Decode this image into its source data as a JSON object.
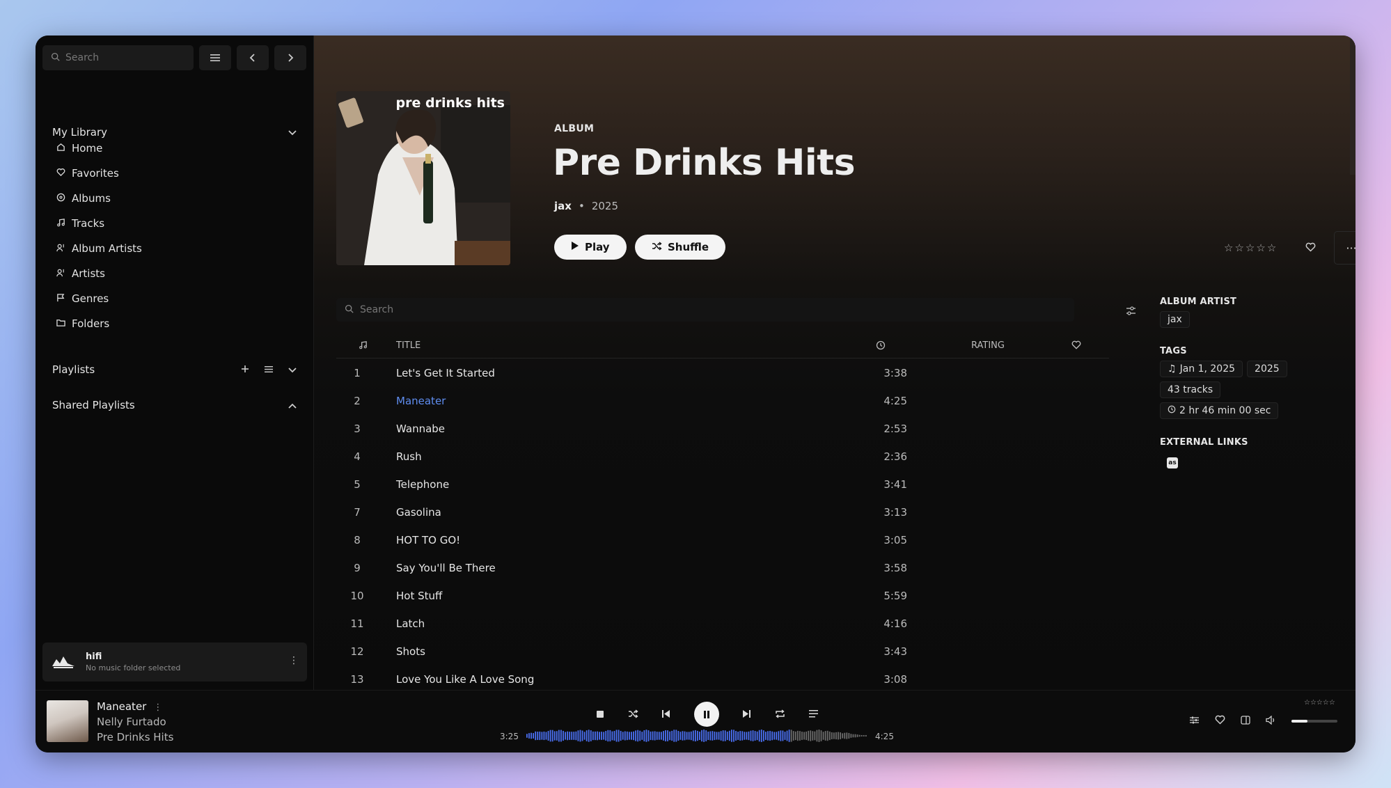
{
  "sidebar": {
    "search_placeholder": "Search",
    "library_label": "My Library",
    "nav": [
      {
        "label": "Home",
        "icon": "home-icon"
      },
      {
        "label": "Favorites",
        "icon": "heart-icon"
      },
      {
        "label": "Albums",
        "icon": "disc-icon"
      },
      {
        "label": "Tracks",
        "icon": "music-note-icon"
      },
      {
        "label": "Album Artists",
        "icon": "user-music-icon"
      },
      {
        "label": "Artists",
        "icon": "user-music-icon"
      },
      {
        "label": "Genres",
        "icon": "flag-icon"
      },
      {
        "label": "Folders",
        "icon": "folder-icon"
      }
    ],
    "playlists_label": "Playlists",
    "shared_playlists_label": "Shared Playlists",
    "server": {
      "name": "hifi",
      "status": "No music folder selected"
    }
  },
  "album": {
    "type_label": "ALBUM",
    "cover_text": "pre drinks hits",
    "title": "Pre Drinks Hits",
    "artist": "jax",
    "separator": "•",
    "year": "2025",
    "play_label": "Play",
    "shuffle_label": "Shuffle",
    "rating_stars": 0
  },
  "tracks": {
    "search_placeholder": "Search",
    "columns": {
      "number_icon": "music-note-icon",
      "title": "TITLE",
      "duration_icon": "clock-icon",
      "rating": "RATING",
      "favorite_icon": "heart-icon"
    },
    "rows": [
      {
        "num": "1",
        "title": "Let's Get It Started",
        "duration": "3:38"
      },
      {
        "num": "2",
        "title": "Maneater",
        "duration": "4:25",
        "active": true
      },
      {
        "num": "3",
        "title": "Wannabe",
        "duration": "2:53"
      },
      {
        "num": "4",
        "title": "Rush",
        "duration": "2:36"
      },
      {
        "num": "5",
        "title": "Telephone",
        "duration": "3:41"
      },
      {
        "num": "7",
        "title": "Gasolina",
        "duration": "3:13"
      },
      {
        "num": "8",
        "title": "HOT TO GO!",
        "duration": "3:05"
      },
      {
        "num": "9",
        "title": "Say You'll Be There",
        "duration": "3:58"
      },
      {
        "num": "10",
        "title": "Hot Stuff",
        "duration": "5:59"
      },
      {
        "num": "11",
        "title": "Latch",
        "duration": "4:16"
      },
      {
        "num": "12",
        "title": "Shots",
        "duration": "3:43"
      },
      {
        "num": "13",
        "title": "Love You Like A Love Song",
        "duration": "3:08"
      }
    ]
  },
  "details": {
    "album_artist_label": "ALBUM ARTIST",
    "album_artist": "jax",
    "tags_label": "TAGS",
    "tags": [
      "Jan 1, 2025",
      "2025",
      "43 tracks"
    ],
    "duration_tag": "2 hr 46 min 00 sec",
    "external_links_label": "EXTERNAL LINKS",
    "lastfm_glyph": "as"
  },
  "player": {
    "title": "Maneater",
    "artist": "Nelly Furtado",
    "album": "Pre Drinks Hits",
    "elapsed": "3:25",
    "total": "4:25",
    "progress": 0.77,
    "volume": 0.35,
    "rating_stars": 0
  },
  "colors": {
    "accent": "#5f8df0",
    "background": "#0f0f0f",
    "wave_played": "#4a6ff0",
    "wave_unplayed": "#6a6a6a"
  }
}
